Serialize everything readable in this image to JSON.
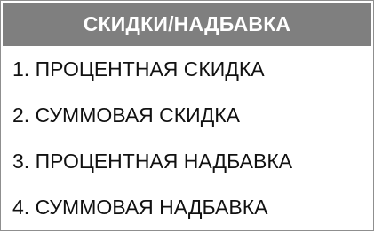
{
  "header": {
    "title": "СКИДКИ/НАДБАВКА"
  },
  "menu": {
    "items": [
      {
        "label": "1. ПРОЦЕНТНАЯ СКИДКА"
      },
      {
        "label": "2. СУММОВАЯ СКИДКА"
      },
      {
        "label": "3. ПРОЦЕНТНАЯ НАДБАВКА"
      },
      {
        "label": "4. СУММОВАЯ НАДБАВКА"
      }
    ]
  },
  "colors": {
    "header_background": "#7f7f7f",
    "header_text": "#ffffff",
    "item_text": "#111111",
    "background": "#ffffff"
  }
}
